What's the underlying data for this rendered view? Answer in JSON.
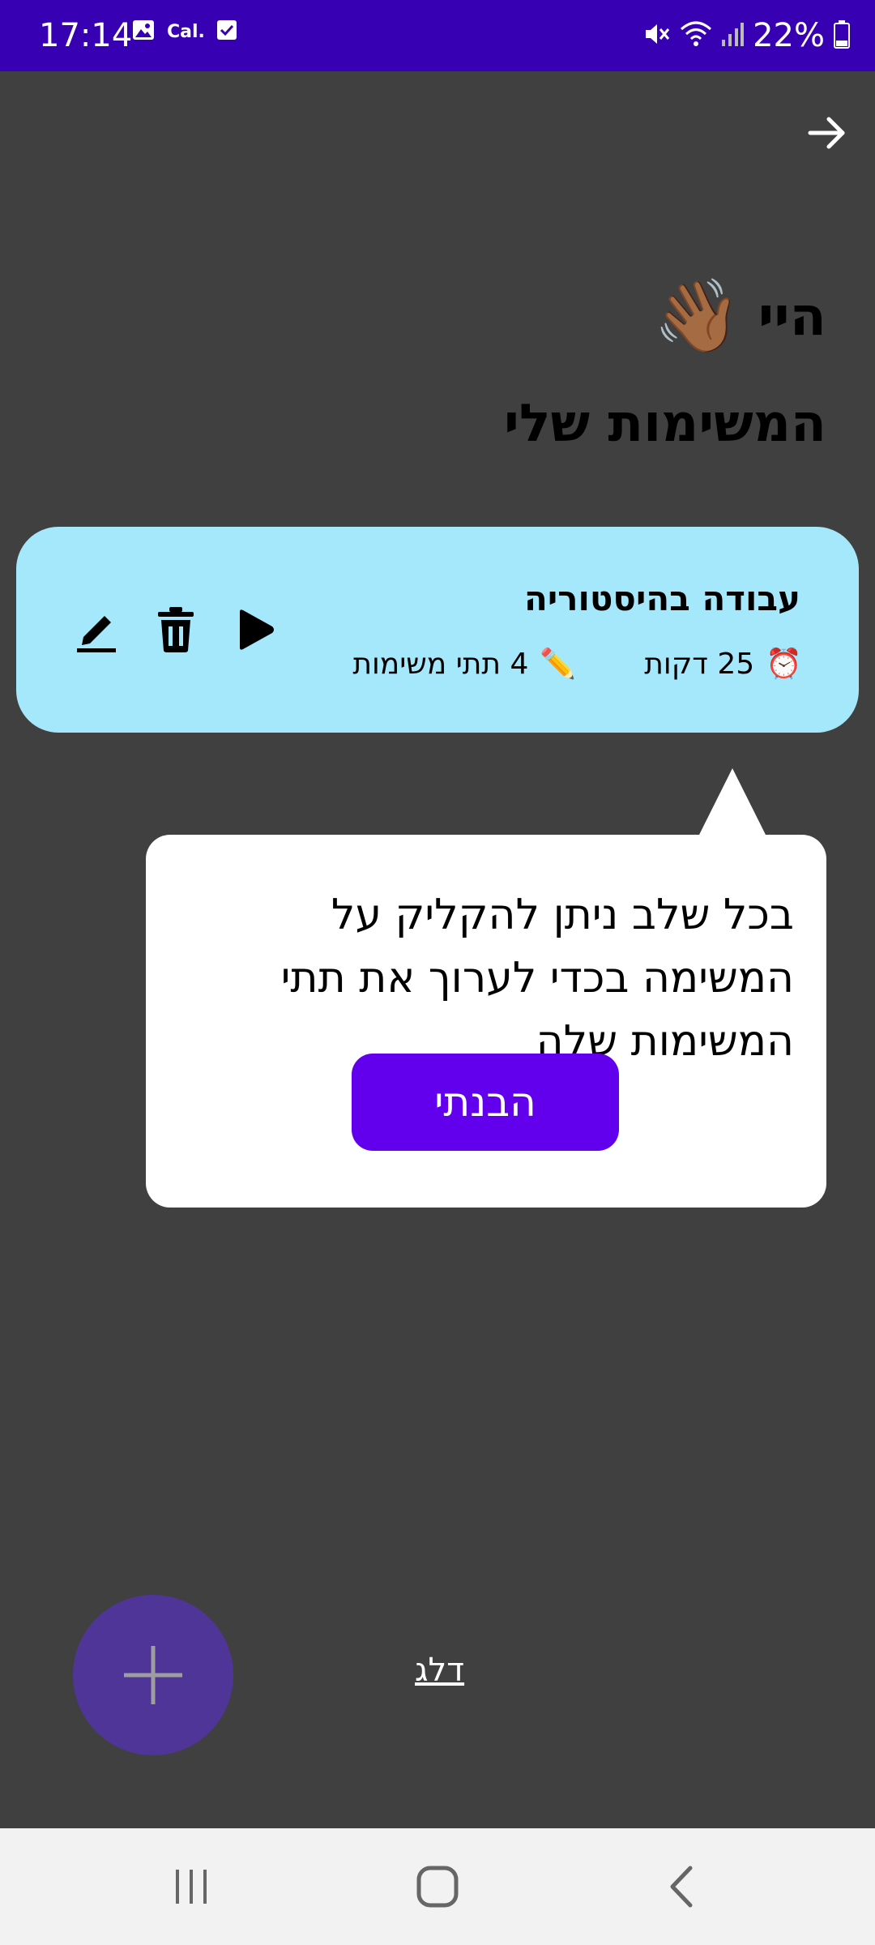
{
  "status_bar": {
    "time": "17:14",
    "cal_label": "Cal.",
    "battery_percent": "22%",
    "icons": [
      "image-icon",
      "calendar-icon",
      "check-box-icon",
      "mute-icon",
      "wifi-icon",
      "signal-icon",
      "battery-icon"
    ]
  },
  "header": {
    "greeting": "היי",
    "wave_emoji": "👋🏾",
    "title": "המשימות שלי"
  },
  "task": {
    "name": "עבודה בהיסטוריה",
    "duration": "25 דקות",
    "duration_icon": "⏰",
    "subtasks": "4 תתי משימות",
    "subtasks_icon": "✏️"
  },
  "tooltip": {
    "text": "בכל שלב ניתן להקליק על המשימה בכדי לערוך את תתי המשימות שלה",
    "button_label": "הבנתי"
  },
  "footer": {
    "skip_label": "דלג"
  },
  "colors": {
    "status_bar": "#3700b3",
    "background": "#404040",
    "card": "#a6e8fb",
    "primary_button": "#6200ee",
    "fab": "#4f3597"
  }
}
